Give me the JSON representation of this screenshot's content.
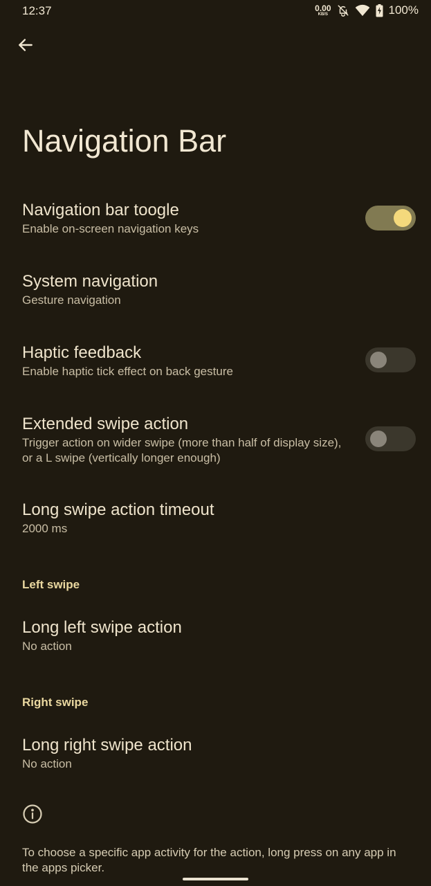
{
  "status_bar": {
    "time": "12:37",
    "net_speed_value": "0.00",
    "net_speed_unit": "KB/S",
    "battery": "100%"
  },
  "header": {
    "title": "Navigation Bar"
  },
  "preferences": {
    "navbar_toggle": {
      "title": "Navigation bar toogle",
      "summary": "Enable on-screen navigation keys",
      "checked": true
    },
    "system_navigation": {
      "title": "System navigation",
      "summary": "Gesture navigation"
    },
    "haptic_feedback": {
      "title": "Haptic feedback",
      "summary": "Enable haptic tick effect on back gesture",
      "checked": false
    },
    "extended_swipe": {
      "title": "Extended swipe action",
      "summary": "Trigger action on wider swipe (more than half of display size), or a L swipe (vertically longer enough)",
      "checked": false
    },
    "long_swipe_timeout": {
      "title": "Long swipe action timeout",
      "summary": "2000 ms"
    }
  },
  "sections": {
    "left_swipe": {
      "header": "Left swipe",
      "long_left": {
        "title": "Long left swipe action",
        "summary": "No action"
      }
    },
    "right_swipe": {
      "header": "Right swipe",
      "long_right": {
        "title": "Long right swipe action",
        "summary": "No action"
      }
    }
  },
  "footer": {
    "note": "To choose a specific app activity for the action, long press on any app in the apps picker."
  },
  "colors": {
    "background": "#1f1a10",
    "accent": "#f4d97c",
    "switch_on_track": "#817a52",
    "switch_off_track": "#3b372c",
    "section_header": "#ead8a0"
  }
}
